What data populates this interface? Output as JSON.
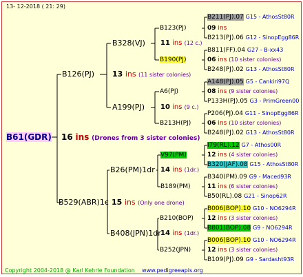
{
  "date": "13- 12-2018 ( 21: 29)",
  "copyright": "Copyright 2004-2018 @ Karl Kehrle Foundation",
  "website": "www.pedigreeapis.org",
  "root": {
    "name": "B61(GDR)",
    "ins": "16",
    "insw": "ins",
    "comment": "(Drones from 3 sister colonies)"
  },
  "g2a": {
    "name": "B126(PJ)",
    "ins": "13",
    "insw": "ins",
    "comment": "(11 sister colonies)"
  },
  "g2b": {
    "name": "B529(ABR)1c",
    "ins": "15",
    "insw": "ins",
    "comment": "(Only one drone)"
  },
  "g3a": {
    "name": "B328(VJ)",
    "ins": "11",
    "insw": "ins",
    "comment": "(12 c.)"
  },
  "g3b": {
    "name": "A199(PJ)",
    "ins": "10",
    "insw": "ins",
    "comment": "(9 c.)"
  },
  "g3c": {
    "name": "B26(PM)1dr",
    "ins": "14",
    "insw": "ins",
    "comment": "(1dr.)"
  },
  "g3d": {
    "name": "B408(JPN)1dr",
    "ins": "14",
    "insw": "ins",
    "comment": "(1dr.)"
  },
  "g4": [
    {
      "name": "B123(PJ)",
      "ins": "09",
      "insw": "ins",
      "comment": ""
    },
    {
      "name": "B190(PJ)",
      "ins": "06",
      "insw": "ins",
      "comment": "(10 sister colonies)"
    },
    {
      "name": "A6(PJ)",
      "ins": "08",
      "insw": "ins",
      "comment": "(9 sister colonies)"
    },
    {
      "name": "B213H(PJ)",
      "ins": "06",
      "insw": "ins",
      "comment": "(10 sister colonies)"
    },
    {
      "name": "V97(PM)",
      "ins": "12",
      "insw": "ins",
      "comment": "(4 sister colonies)"
    },
    {
      "name": "B189(PM)",
      "ins": "11",
      "insw": "ins",
      "comment": "(6 sister colonies)"
    },
    {
      "name": "B210(BOP)",
      "ins": "12",
      "insw": "ins",
      "comment": "(3 sister colonies)"
    },
    {
      "name": "B252(JPN)",
      "ins": "12",
      "insw": "ins",
      "comment": "(3 sister colonies)"
    }
  ],
  "g5": [
    {
      "name": "B211(PJ).07",
      "info": "G15 - AthosSt80R"
    },
    {
      "name": "B213(PJ).06",
      "info": "G12 - SinopEgg86R"
    },
    {
      "name": "B811(FF).04",
      "info": "G27 - B-xx43"
    },
    {
      "name": "B248(PJ).02",
      "info": "G13 - AthosSt80R"
    },
    {
      "name": "A148(PJ).05",
      "info": "G5 - Cankiri97Q"
    },
    {
      "name": "P133H(PJ).05",
      "info": "G3 - PrimGreen00"
    },
    {
      "name": "P206(PJ).04",
      "info": "G11 - SinopEgg86R"
    },
    {
      "name": "B248(PJ).02",
      "info": "G13 - AthosSt80R"
    },
    {
      "name": "I79(RL).12",
      "info": "G7 - Athos00R"
    },
    {
      "name": "B320(JAF).08",
      "info": "G15 - AthosSt80R"
    },
    {
      "name": "B340(PM).09",
      "info": "G9 - Maced93R"
    },
    {
      "name": "B50(RL).08",
      "info": "G21 - Sinop62R"
    },
    {
      "name": "B006(BOP).10",
      "info": "G10 - NO6294R"
    },
    {
      "name": "B801(BOP).08",
      "info": "G9 - NO6294R"
    },
    {
      "name": "B006(BOP).10",
      "info": "G10 - NO6294R"
    },
    {
      "name": "B109(PJ).09",
      "info": "G9 - Sardasht93R"
    }
  ],
  "colors": {
    "border": "#cc3333",
    "background": "#ffffd8",
    "ins": "#cc0000",
    "root": "#000080",
    "comment": "#660099",
    "link": "#0000cc",
    "copyright": "#00aa00"
  }
}
